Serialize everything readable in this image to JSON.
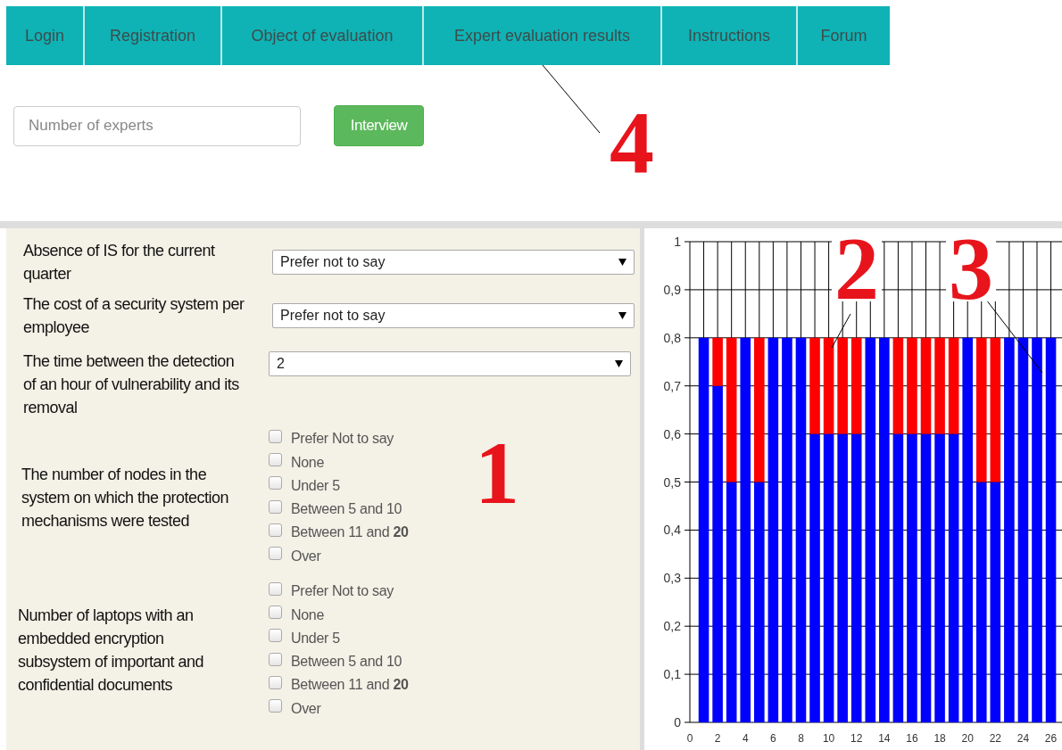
{
  "nav": [
    {
      "label": "Login"
    },
    {
      "label": "Registration"
    },
    {
      "label": "Object of evaluation"
    },
    {
      "label": "Expert evaluation results"
    },
    {
      "label": "Instructions"
    },
    {
      "label": "Forum"
    }
  ],
  "experts_field": {
    "placeholder": "Number of experts"
  },
  "interview_button": "Interview",
  "header_callout": "4",
  "questions": [
    {
      "kind": "select",
      "label": "Absence of IS for the current quarter",
      "value": "Prefer not to say"
    },
    {
      "kind": "select",
      "label": "The cost of a security system per employee",
      "value": "Prefer not to say"
    },
    {
      "kind": "select",
      "label": "The time between the detection of an hour of vulnerability and its removal",
      "value": "2"
    },
    {
      "kind": "checkboxes",
      "label": "The number of nodes in the system on which the protection mechanisms were tested",
      "options": [
        {
          "label": "Prefer Not to say",
          "checked": false
        },
        {
          "label": "None",
          "checked": false
        },
        {
          "label": "Under 5",
          "checked": false
        },
        {
          "label": "Between 5 and 10",
          "checked": false
        },
        {
          "label": "Between 11 and **20**",
          "checked": false
        },
        {
          "label": "Over",
          "checked": false
        }
      ]
    },
    {
      "kind": "checkboxes",
      "label": "Number of laptops with an embedded encryption subsystem of important and confidential documents",
      "options": [
        {
          "label": "Prefer Not to say",
          "checked": false
        },
        {
          "label": "None",
          "checked": false
        },
        {
          "label": "Under 5",
          "checked": false
        },
        {
          "label": "Between 5 and 10",
          "checked": false
        },
        {
          "label": "Between 11 and **20**",
          "checked": false
        },
        {
          "label": "Over",
          "checked": false
        }
      ]
    }
  ],
  "form_callout": "1",
  "chart": {
    "chart_data": {
      "type": "bar",
      "stacked": true,
      "grid": true,
      "x": [
        1,
        2,
        3,
        4,
        5,
        6,
        7,
        8,
        9,
        10,
        11,
        12,
        13,
        14,
        15,
        16,
        17,
        18,
        19,
        20,
        21,
        22,
        23,
        24,
        25,
        26
      ],
      "series": [
        {
          "color": "#0000ff",
          "values": [
            0.8,
            0.7,
            0.5,
            0.8,
            0.5,
            0.8,
            0.8,
            0.8,
            0.6,
            0.6,
            0.6,
            0.6,
            0.8,
            0.8,
            0.6,
            0.6,
            0.6,
            0.6,
            0.6,
            0.8,
            0.5,
            0.5,
            0.8,
            0.8,
            0.8,
            0.8
          ]
        },
        {
          "color": "#ff0000",
          "values": [
            0,
            0.1,
            0.3,
            0,
            0.3,
            0,
            0,
            0,
            0.2,
            0.2,
            0.2,
            0.2,
            0,
            0,
            0.2,
            0.2,
            0.2,
            0.2,
            0.2,
            0,
            0.3,
            0.3,
            0,
            0,
            0,
            0
          ]
        }
      ],
      "xticks": [
        0,
        2,
        4,
        6,
        8,
        10,
        12,
        14,
        16,
        18,
        20,
        22,
        24,
        26
      ],
      "yticks": [
        {
          "value": 0,
          "label": "0"
        },
        {
          "value": 0.1,
          "label": "0,1"
        },
        {
          "value": 0.2,
          "label": "0,2"
        },
        {
          "value": 0.3,
          "label": "0,3"
        },
        {
          "value": 0.4,
          "label": "0,4"
        },
        {
          "value": 0.5,
          "label": "0,5"
        },
        {
          "value": 0.6,
          "label": "0,6"
        },
        {
          "value": 0.7,
          "label": "0,7"
        },
        {
          "value": 0.8,
          "label": "0,8"
        },
        {
          "value": 0.9,
          "label": "0,9"
        },
        {
          "value": 1,
          "label": "1"
        }
      ],
      "ylim": [
        0,
        1
      ],
      "xlim": [
        0,
        26.8
      ],
      "annotations": [
        {
          "text": "2"
        },
        {
          "text": "3"
        }
      ]
    }
  }
}
